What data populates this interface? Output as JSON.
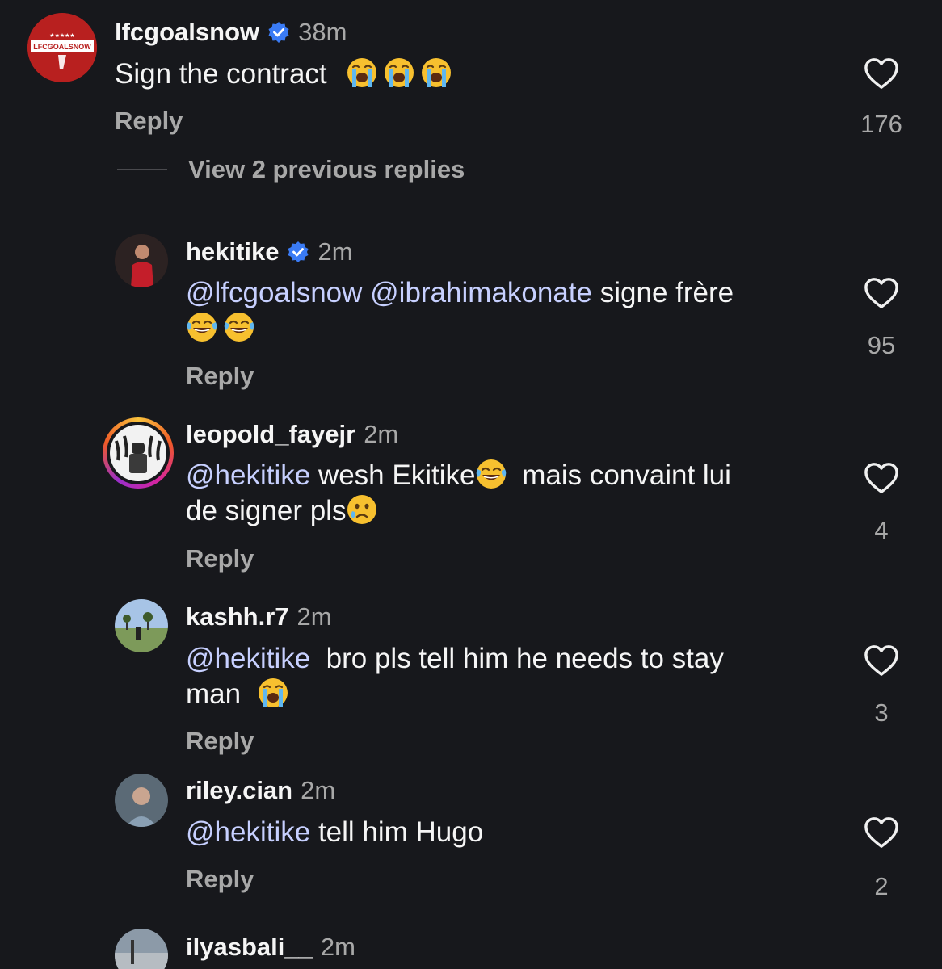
{
  "view_previous_replies": "View 2 previous replies",
  "reply_label": "Reply",
  "colors": {
    "background": "#17181c",
    "mention": "#c7d0ff",
    "verified": "#3a7bf5"
  },
  "comments": [
    {
      "username": "lfcgoalsnow",
      "time": "38m",
      "verified": true,
      "avatar_text": "LFCGOALSNOW",
      "text": "Sign the contract",
      "emojis": [
        "loudly-crying",
        "loudly-crying",
        "loudly-crying"
      ],
      "likes": "176"
    },
    {
      "username": "hekitike",
      "time": "2m",
      "verified": true,
      "mentions": [
        "@lfcgoalsnow",
        "@ibrahimakonate"
      ],
      "text": "signe frère",
      "emojis": [
        "tears-of-joy",
        "tears-of-joy"
      ],
      "likes": "95"
    },
    {
      "username": "leopold_fayejr",
      "time": "2m",
      "mention": "@hekitike",
      "text_a": "wesh Ekitike",
      "text_b": "mais convaint lui",
      "text_c": "de signer pls",
      "emojis": [
        "tears-of-joy",
        "crying"
      ],
      "likes": "4"
    },
    {
      "username": "kashh.r7",
      "time": "2m",
      "mention": "@hekitike",
      "text_a": "bro pls tell him he needs to stay",
      "text_b": "man",
      "emojis": [
        "loudly-crying"
      ],
      "likes": "3"
    },
    {
      "username": "riley.cian",
      "time": "2m",
      "mention": "@hekitike",
      "text": "tell him Hugo",
      "likes": "2"
    },
    {
      "username": "ilyasbali__",
      "time": "2m"
    }
  ]
}
